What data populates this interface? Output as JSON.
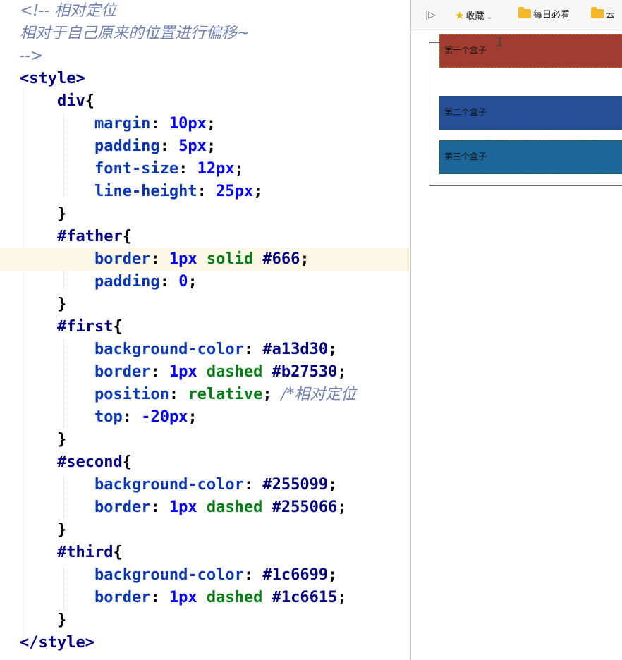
{
  "editor": {
    "lines": [
      {
        "parts": [
          {
            "t": "<!-- ",
            "c": "c-comment"
          },
          {
            "t": "相对定位",
            "c": "c-comment"
          }
        ]
      },
      {
        "parts": [
          {
            "t": "相对于自己原来的位置进行偏移~",
            "c": "c-comment"
          }
        ]
      },
      {
        "parts": [
          {
            "t": "-->",
            "c": "c-comment"
          }
        ]
      },
      {
        "parts": [
          {
            "t": "<style>",
            "c": "c-tag"
          }
        ]
      },
      {
        "parts": [
          {
            "t": "    div",
            "c": "c-sel"
          },
          {
            "t": "{",
            "c": "c-punc"
          }
        ]
      },
      {
        "parts": [
          {
            "t": "        margin",
            "c": "c-prop"
          },
          {
            "t": ": ",
            "c": "c-punc"
          },
          {
            "t": "10px",
            "c": "c-num"
          },
          {
            "t": ";",
            "c": "c-punc"
          }
        ]
      },
      {
        "parts": [
          {
            "t": "        padding",
            "c": "c-prop"
          },
          {
            "t": ": ",
            "c": "c-punc"
          },
          {
            "t": "5px",
            "c": "c-num"
          },
          {
            "t": ";",
            "c": "c-punc"
          }
        ]
      },
      {
        "parts": [
          {
            "t": "        font-size",
            "c": "c-prop"
          },
          {
            "t": ": ",
            "c": "c-punc"
          },
          {
            "t": "12px",
            "c": "c-num"
          },
          {
            "t": ";",
            "c": "c-punc"
          }
        ]
      },
      {
        "parts": [
          {
            "t": "        line-height",
            "c": "c-prop"
          },
          {
            "t": ": ",
            "c": "c-punc"
          },
          {
            "t": "25px",
            "c": "c-num"
          },
          {
            "t": ";",
            "c": "c-punc"
          }
        ]
      },
      {
        "parts": [
          {
            "t": "    }",
            "c": "c-punc"
          }
        ]
      },
      {
        "parts": [
          {
            "t": "    #father",
            "c": "c-sel"
          },
          {
            "t": "{",
            "c": "c-punc"
          }
        ]
      },
      {
        "parts": [
          {
            "t": "        border",
            "c": "c-prop"
          },
          {
            "t": ": ",
            "c": "c-punc"
          },
          {
            "t": "1px",
            "c": "c-num"
          },
          {
            "t": " solid ",
            "c": "c-kw"
          },
          {
            "t": "#666",
            "c": "c-hex"
          },
          {
            "t": ";",
            "c": "c-punc"
          }
        ],
        "highlight": true
      },
      {
        "parts": [
          {
            "t": "        padding",
            "c": "c-prop"
          },
          {
            "t": ": ",
            "c": "c-punc"
          },
          {
            "t": "0",
            "c": "c-num"
          },
          {
            "t": ";",
            "c": "c-punc"
          }
        ]
      },
      {
        "parts": [
          {
            "t": "    }",
            "c": "c-punc"
          }
        ]
      },
      {
        "parts": [
          {
            "t": "    #first",
            "c": "c-sel"
          },
          {
            "t": "{",
            "c": "c-punc"
          }
        ]
      },
      {
        "parts": [
          {
            "t": "        background-color",
            "c": "c-prop"
          },
          {
            "t": ": ",
            "c": "c-punc"
          },
          {
            "t": "#a13d30",
            "c": "c-hex"
          },
          {
            "t": ";",
            "c": "c-punc"
          }
        ]
      },
      {
        "parts": [
          {
            "t": "        border",
            "c": "c-prop"
          },
          {
            "t": ": ",
            "c": "c-punc"
          },
          {
            "t": "1px",
            "c": "c-num"
          },
          {
            "t": " dashed ",
            "c": "c-kw"
          },
          {
            "t": "#b27530",
            "c": "c-hex"
          },
          {
            "t": ";",
            "c": "c-punc"
          }
        ]
      },
      {
        "parts": [
          {
            "t": "        position",
            "c": "c-prop"
          },
          {
            "t": ": ",
            "c": "c-punc"
          },
          {
            "t": "relative",
            "c": "c-kw"
          },
          {
            "t": "; ",
            "c": "c-punc"
          },
          {
            "t": "/*相对定位",
            "c": "c-italic"
          }
        ]
      },
      {
        "parts": [
          {
            "t": "        top",
            "c": "c-prop"
          },
          {
            "t": ": ",
            "c": "c-punc"
          },
          {
            "t": "-20px",
            "c": "c-num"
          },
          {
            "t": ";",
            "c": "c-punc"
          }
        ]
      },
      {
        "parts": [
          {
            "t": "    }",
            "c": "c-punc"
          }
        ]
      },
      {
        "parts": [
          {
            "t": "    #second",
            "c": "c-sel"
          },
          {
            "t": "{",
            "c": "c-punc"
          }
        ]
      },
      {
        "parts": [
          {
            "t": "        background-color",
            "c": "c-prop"
          },
          {
            "t": ": ",
            "c": "c-punc"
          },
          {
            "t": "#255099",
            "c": "c-hex"
          },
          {
            "t": ";",
            "c": "c-punc"
          }
        ]
      },
      {
        "parts": [
          {
            "t": "        border",
            "c": "c-prop"
          },
          {
            "t": ": ",
            "c": "c-punc"
          },
          {
            "t": "1px",
            "c": "c-num"
          },
          {
            "t": " dashed ",
            "c": "c-kw"
          },
          {
            "t": "#255066",
            "c": "c-hex"
          },
          {
            "t": ";",
            "c": "c-punc"
          }
        ]
      },
      {
        "parts": [
          {
            "t": "    }",
            "c": "c-punc"
          }
        ]
      },
      {
        "parts": [
          {
            "t": "    #third",
            "c": "c-sel"
          },
          {
            "t": "{",
            "c": "c-punc"
          }
        ]
      },
      {
        "parts": [
          {
            "t": "        background-color",
            "c": "c-prop"
          },
          {
            "t": ": ",
            "c": "c-punc"
          },
          {
            "t": "#1c6699",
            "c": "c-hex"
          },
          {
            "t": ";",
            "c": "c-punc"
          }
        ]
      },
      {
        "parts": [
          {
            "t": "        border",
            "c": "c-prop"
          },
          {
            "t": ": ",
            "c": "c-punc"
          },
          {
            "t": "1px",
            "c": "c-num"
          },
          {
            "t": " dashed ",
            "c": "c-kw"
          },
          {
            "t": "#1c6615",
            "c": "c-hex"
          },
          {
            "t": ";",
            "c": "c-punc"
          }
        ]
      },
      {
        "parts": [
          {
            "t": "    }",
            "c": "c-punc"
          }
        ]
      },
      {
        "parts": [
          {
            "t": "</style>",
            "c": "c-tag"
          }
        ]
      }
    ]
  },
  "browser": {
    "bookmarks": {
      "sidebar_toggle": "|▷",
      "favorites_label": "收藏",
      "daily_label": "每日必看",
      "cloud_label": "云"
    },
    "boxes": {
      "first": "第一个盒子",
      "second": "第二个盒子",
      "third": "第三个盒子"
    },
    "colors": {
      "first_bg": "#a13d30",
      "second_bg": "#255099",
      "third_bg": "#1c6699"
    }
  }
}
